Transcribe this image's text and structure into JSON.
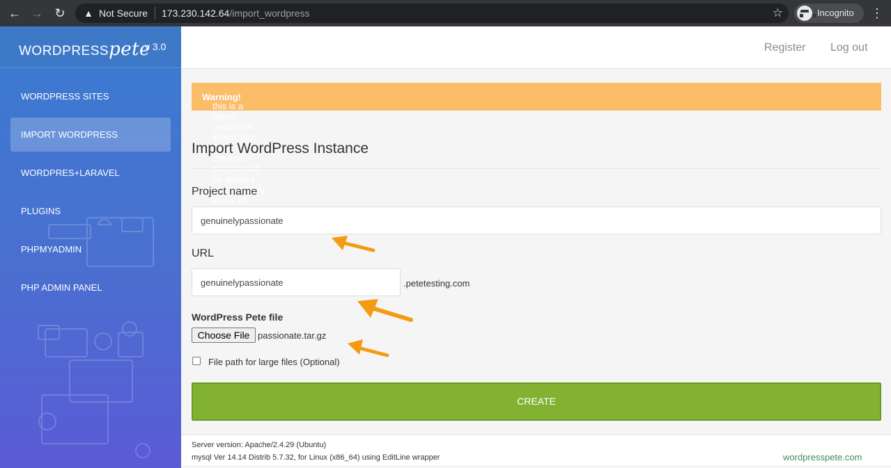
{
  "browser": {
    "security_label": "Not Secure",
    "url_host": "173.230.142.64",
    "url_path": "/import_wordpress",
    "profile_label": "Incognito"
  },
  "sidebar": {
    "logo_word": "WORDPRESS",
    "logo_script": "pete",
    "version": "v 3.0",
    "items": [
      {
        "label": "WORDPRESS SITES",
        "active": false
      },
      {
        "label": "IMPORT WORDPRESS",
        "active": true
      },
      {
        "label": "WORDPRES+LARAVEL",
        "active": false
      },
      {
        "label": "PLUGINS",
        "active": false
      },
      {
        "label": "PHPMYADMIN",
        "active": false
      },
      {
        "label": "PHP ADMIN PANEL",
        "active": false
      }
    ]
  },
  "topbar": {
    "register": "Register",
    "logout": "Log out"
  },
  "alert": {
    "strong": "Warning!",
    "message": " this is a demo version of WordPress Pete, all created projects will be deleted automatically every 24 hours."
  },
  "form": {
    "title": "Import WordPress Instance",
    "project_label": "Project name",
    "project_value": "genuinelypassionate",
    "url_label": "URL",
    "url_value": "genuinelypassionate",
    "url_suffix": ".petetesting.com",
    "file_label": "WordPress Pete file",
    "choose_file": "Choose File",
    "file_name": "passionate.tar.gz",
    "large_files_label": "File path for large files (Optional)",
    "large_files_checked": false,
    "create": "CREATE"
  },
  "footer": {
    "server_version": "Server version: Apache/2.4.29 (Ubuntu)",
    "mysql_version": "mysql Ver 14.14 Distrib 5.7.32, for Linux (x86_64) using EditLine wrapper",
    "site_link": "wordpresspete.com"
  },
  "colors": {
    "sidebar_top": "#3b7bd0",
    "sidebar_bottom": "#5a5bd6",
    "alert": "#fcbd69",
    "create_button": "#83b233",
    "annotation_arrow": "#f39c12"
  }
}
